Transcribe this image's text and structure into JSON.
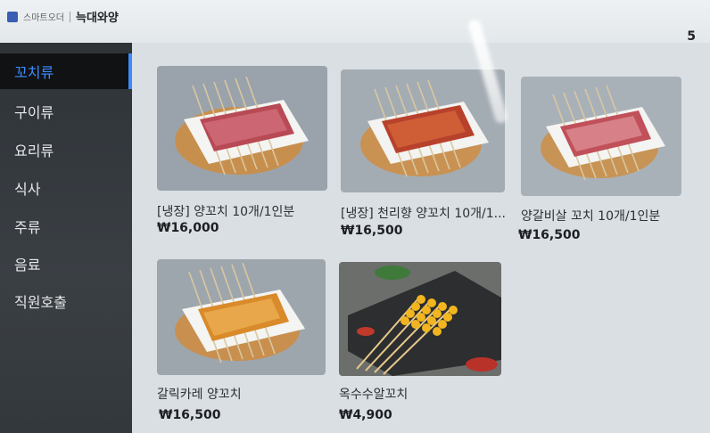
{
  "header": {
    "brand_name": "스마트오더",
    "store_name": "늑대와양",
    "table_number": "5"
  },
  "sidebar": {
    "items": [
      {
        "label": "꼬치류",
        "active": true
      },
      {
        "label": "구이류",
        "active": false
      },
      {
        "label": "요리류",
        "active": false
      },
      {
        "label": "식사",
        "active": false
      },
      {
        "label": "주류",
        "active": false
      },
      {
        "label": "음료",
        "active": false
      },
      {
        "label": "직원호출",
        "active": false
      }
    ]
  },
  "menu": {
    "items": [
      {
        "name": "[냉장] 양꼬치 10개/1인분",
        "price": "₩16,000",
        "image": "lamb-skewers-on-board"
      },
      {
        "name": "[냉장] 천리향 양꼬치 10개/1...",
        "price": "₩16,500",
        "image": "spicy-lamb-skewers-on-board"
      },
      {
        "name": "양갈비살 꼬치 10개/1인분",
        "price": "₩16,500",
        "image": "lamb-rib-skewers-on-board"
      },
      {
        "name": "갈릭카레 양꼬치",
        "price": "₩16,500",
        "image": "garlic-curry-lamb-skewers"
      },
      {
        "name": "옥수수알꼬치",
        "price": "₩4,900",
        "image": "corn-skewers-on-slate"
      }
    ]
  },
  "colors": {
    "accent": "#3d8cff",
    "sidebar_bg": "#33383c",
    "content_bg": "#d9dfe3"
  }
}
